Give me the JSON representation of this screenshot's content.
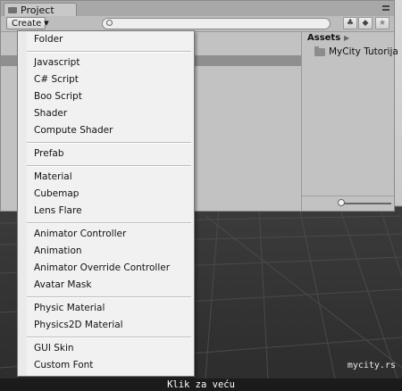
{
  "window": {
    "tab_label": "Project",
    "create_label": "Create"
  },
  "assets": {
    "header": "Assets",
    "folder_label": "MyCity Tutorija"
  },
  "menu": {
    "groups": [
      [
        "Folder"
      ],
      [
        "Javascript",
        "C# Script",
        "Boo Script",
        "Shader",
        "Compute Shader"
      ],
      [
        "Prefab"
      ],
      [
        "Material",
        "Cubemap",
        "Lens Flare"
      ],
      [
        "Animator Controller",
        "Animation",
        "Animator Override Controller",
        "Avatar Mask"
      ],
      [
        "Physic Material",
        "Physics2D Material"
      ],
      [
        "GUI Skin",
        "Custom Font"
      ]
    ]
  },
  "icons": {
    "tab": "folder-icon",
    "window_menu": "window-menu-icon",
    "search": "search-icon",
    "filter_type": "filter-by-type-icon",
    "filter_label": "filter-by-label-icon",
    "favorite": "star-icon",
    "asset_folder": "folder-icon"
  },
  "watermark": "mycity.rs",
  "caption": "Klik za veću"
}
